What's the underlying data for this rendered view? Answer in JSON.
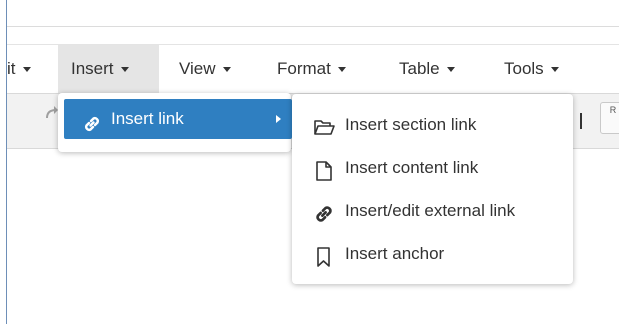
{
  "menubar": {
    "items": [
      {
        "label": "it",
        "caret": true
      },
      {
        "label": "Insert",
        "caret": true,
        "active": true
      },
      {
        "label": "View",
        "caret": true
      },
      {
        "label": "Format",
        "caret": true
      },
      {
        "label": "Table",
        "caret": true
      },
      {
        "label": "Tools",
        "caret": true
      }
    ]
  },
  "insert_menu": {
    "item_label": "Insert link",
    "item_icon": "link-icon",
    "highlight_color": "#2f7fc1"
  },
  "submenu": {
    "items": [
      {
        "label": "Insert section link",
        "icon": "folder-open-icon"
      },
      {
        "label": "Insert content link",
        "icon": "document-icon"
      },
      {
        "label": "Insert/edit external link",
        "icon": "link-icon"
      },
      {
        "label": "Insert anchor",
        "icon": "bookmark-icon"
      }
    ]
  },
  "toolbar": {
    "redo_icon": "redo-icon",
    "partial_button_glyph": "R"
  }
}
